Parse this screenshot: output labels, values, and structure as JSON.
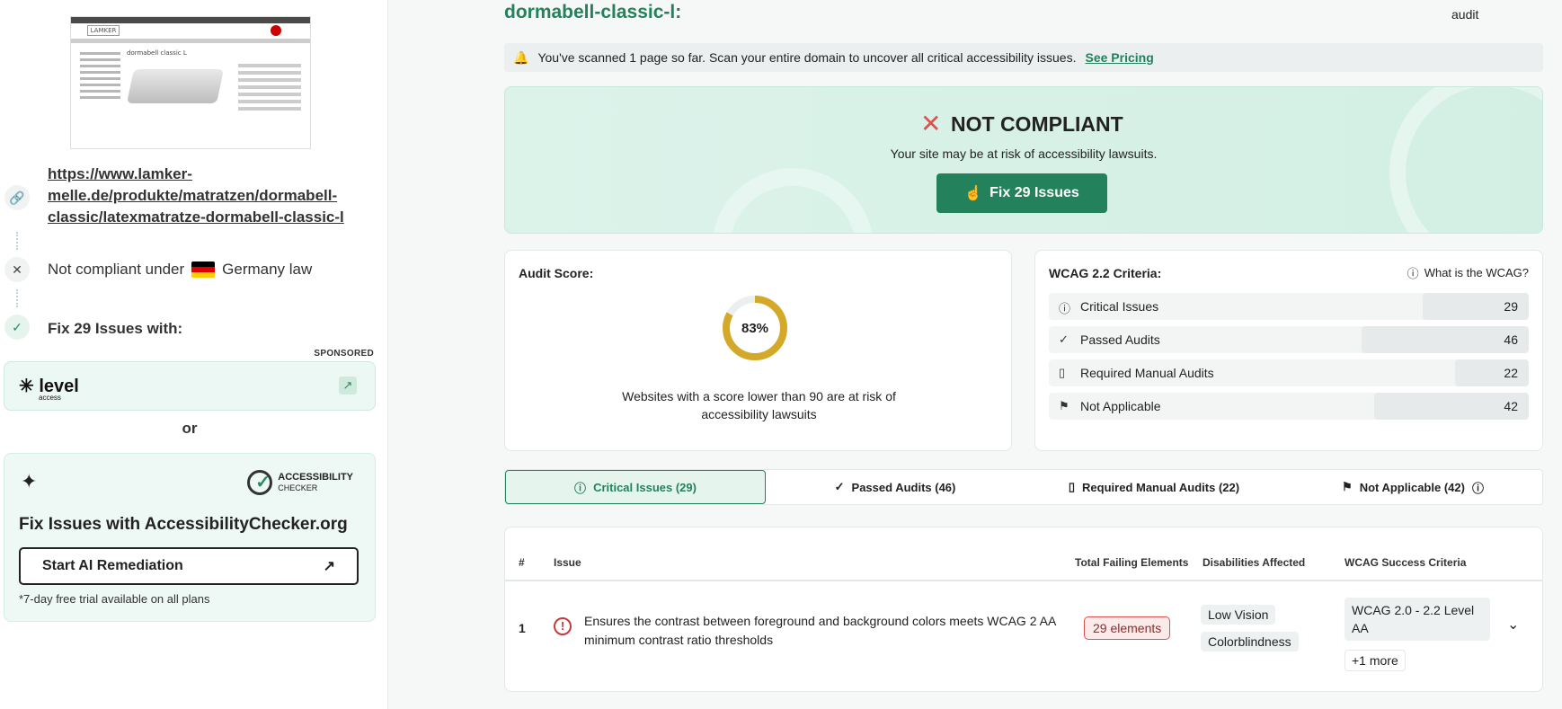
{
  "left": {
    "url": "https://www.lamker-melle.de/produkte/matratzen/dormabell-classic/latexmatratze-dormabell-classic-l",
    "law_prefix": "Not compliant under",
    "law_country": "Germany law",
    "fix_with": "Fix 29 Issues with:",
    "sponsored": "SPONSORED",
    "level_logo": "level",
    "level_logo_sub": "access",
    "or": "or",
    "ac_brand": "ACCESSIBILITY",
    "ac_brand_sub": "CHECKER",
    "ac_heading": "Fix Issues with AccessibilityChecker.org",
    "ac_button": "Start AI Remediation",
    "ac_note": "*7-day free trial available on all plans",
    "thumb_logo": "LAMKER",
    "thumb_title": "dormabell classic L"
  },
  "header": {
    "title": "dormabell-classic-l:",
    "audit": "audit"
  },
  "banner": {
    "text": "You've scanned 1 page so far. Scan your entire domain to uncover all critical accessibility issues.",
    "link": "See Pricing"
  },
  "hero": {
    "status": "NOT COMPLIANT",
    "subtitle": "Your site may be at risk of accessibility lawsuits.",
    "button": "Fix 29 Issues"
  },
  "score": {
    "label": "Audit Score:",
    "value": 83,
    "value_text": "83%",
    "risk": "Websites with a score lower than 90 are at risk of accessibility lawsuits",
    "ring_color": "#d4a92a"
  },
  "wcag": {
    "label": "WCAG 2.2 Criteria:",
    "what": "What is the WCAG?",
    "rows": [
      {
        "label": "Critical Issues",
        "value": "29",
        "icon": "alert-circle-icon"
      },
      {
        "label": "Passed Audits",
        "value": "46",
        "icon": "check-icon"
      },
      {
        "label": "Required Manual Audits",
        "value": "22",
        "icon": "document-icon"
      },
      {
        "label": "Not Applicable",
        "value": "42",
        "icon": "flag-icon"
      }
    ]
  },
  "tabs": [
    {
      "label": "Critical Issues (29)"
    },
    {
      "label": "Passed Audits (46)"
    },
    {
      "label": "Required Manual Audits (22)"
    },
    {
      "label": "Not Applicable (42)"
    }
  ],
  "table": {
    "headers": [
      "#",
      "Issue",
      "Total Failing Elements",
      "Disabilities Affected",
      "WCAG Success Criteria"
    ],
    "rows": [
      {
        "num": "1",
        "issue": "Ensures the contrast between foreground and background colors meets WCAG 2 AA minimum contrast ratio thresholds",
        "elements": "29 elements",
        "disabilities": [
          "Low Vision",
          "Colorblindness"
        ],
        "criteria": "WCAG 2.0 - 2.2 Level AA",
        "more": "+1 more"
      }
    ]
  },
  "colors": {
    "brand": "#23825c",
    "danger": "#d9534f"
  }
}
